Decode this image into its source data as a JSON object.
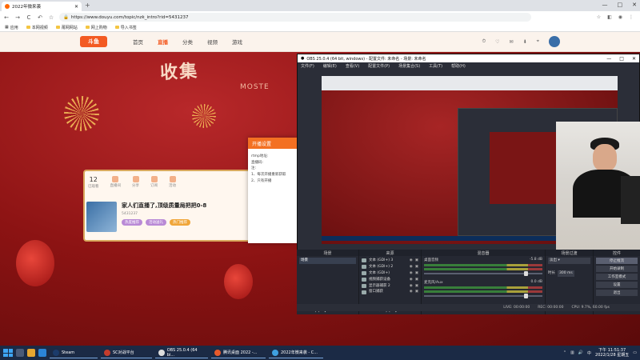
{
  "chrome": {
    "tab_title": "2022年微来袭",
    "url": "https://www.douyu.com/topic/nzk_intro?rid=5431237",
    "new_tab": "+",
    "window_controls": [
      "—",
      "□",
      "✕"
    ],
    "nav": {
      "back": "←",
      "forward": "→",
      "reload": "C",
      "undo": "↶",
      "star": "☆"
    },
    "bookmarks": [
      "应用",
      "本网视频",
      "莆网网站",
      "网上购物",
      "导入书签"
    ]
  },
  "douyu": {
    "logo": "斗鱼",
    "nav_items": [
      "首页",
      "直播",
      "分类",
      "视频",
      "游戏"
    ],
    "active_nav": "直播",
    "banner_title": "收集",
    "banner_sub": "MOSTE",
    "stats": [
      {
        "num": "12",
        "label": "已观看"
      },
      {
        "num": "",
        "label": "直播间"
      },
      {
        "num": "",
        "label": "分享"
      },
      {
        "num": "",
        "label": "订阅"
      },
      {
        "num": "",
        "label": "活动"
      }
    ],
    "room": {
      "title": "家人们直播了,顶级质量局把把0-8",
      "meta": "5431237",
      "tags": [
        "热度推荐",
        "活动送礼",
        "热门推荐"
      ]
    }
  },
  "dialog": {
    "title": "开播设置",
    "rows": [
      "rtmp地址:",
      "直播码:",
      "注:",
      "1、每次开播重新获取",
      "2、只有开播"
    ]
  },
  "obs": {
    "title": "OBS 25.0.4 (64 bit, windows) - 配置文件: 未命名 - 场景: 未命名",
    "menu": [
      "文件(F)",
      "编辑(E)",
      "查看(V)",
      "配置文件(P)",
      "场景集合(S)",
      "工具(T)",
      "帮助(H)"
    ],
    "docks": {
      "scenes_header": "场景",
      "scenes": [
        "场景"
      ],
      "sources_header": "来源",
      "sources": [
        "文本 (GDI+) 3",
        "文本 (GDI+) 2",
        "文本 (GDI+)",
        "视频捕获设备",
        "显示器捕获 2",
        "窗口捕获"
      ],
      "mixer_header": "混音器",
      "mixer": [
        {
          "name": "桌面音频",
          "level": "-5.8 dB"
        },
        {
          "name": "麦克风/Aux",
          "level": "0.0 dB"
        }
      ],
      "transitions_header": "场景过渡",
      "transition_type": "淡出",
      "transition_duration_label": "时长",
      "transition_duration": "300 ms",
      "controls_header": "控件",
      "controls": [
        "停止推流",
        "开始录制",
        "工作室模式",
        "设置",
        "退出"
      ]
    },
    "status": {
      "live": "LIVE: 00:00:00",
      "rec": "REC: 00:00:00",
      "cpu": "CPU: 9.7%, 60.00 fps"
    }
  },
  "taskbar": {
    "apps": [
      "Steam",
      "SC对战平台",
      "OBS 25.0.4 (64 bi...",
      "腾讯桌面 2022 -...",
      "2022年微来袭 - C..."
    ],
    "time": "下午 11:51:37",
    "date": "2022/1/28 星期五"
  }
}
